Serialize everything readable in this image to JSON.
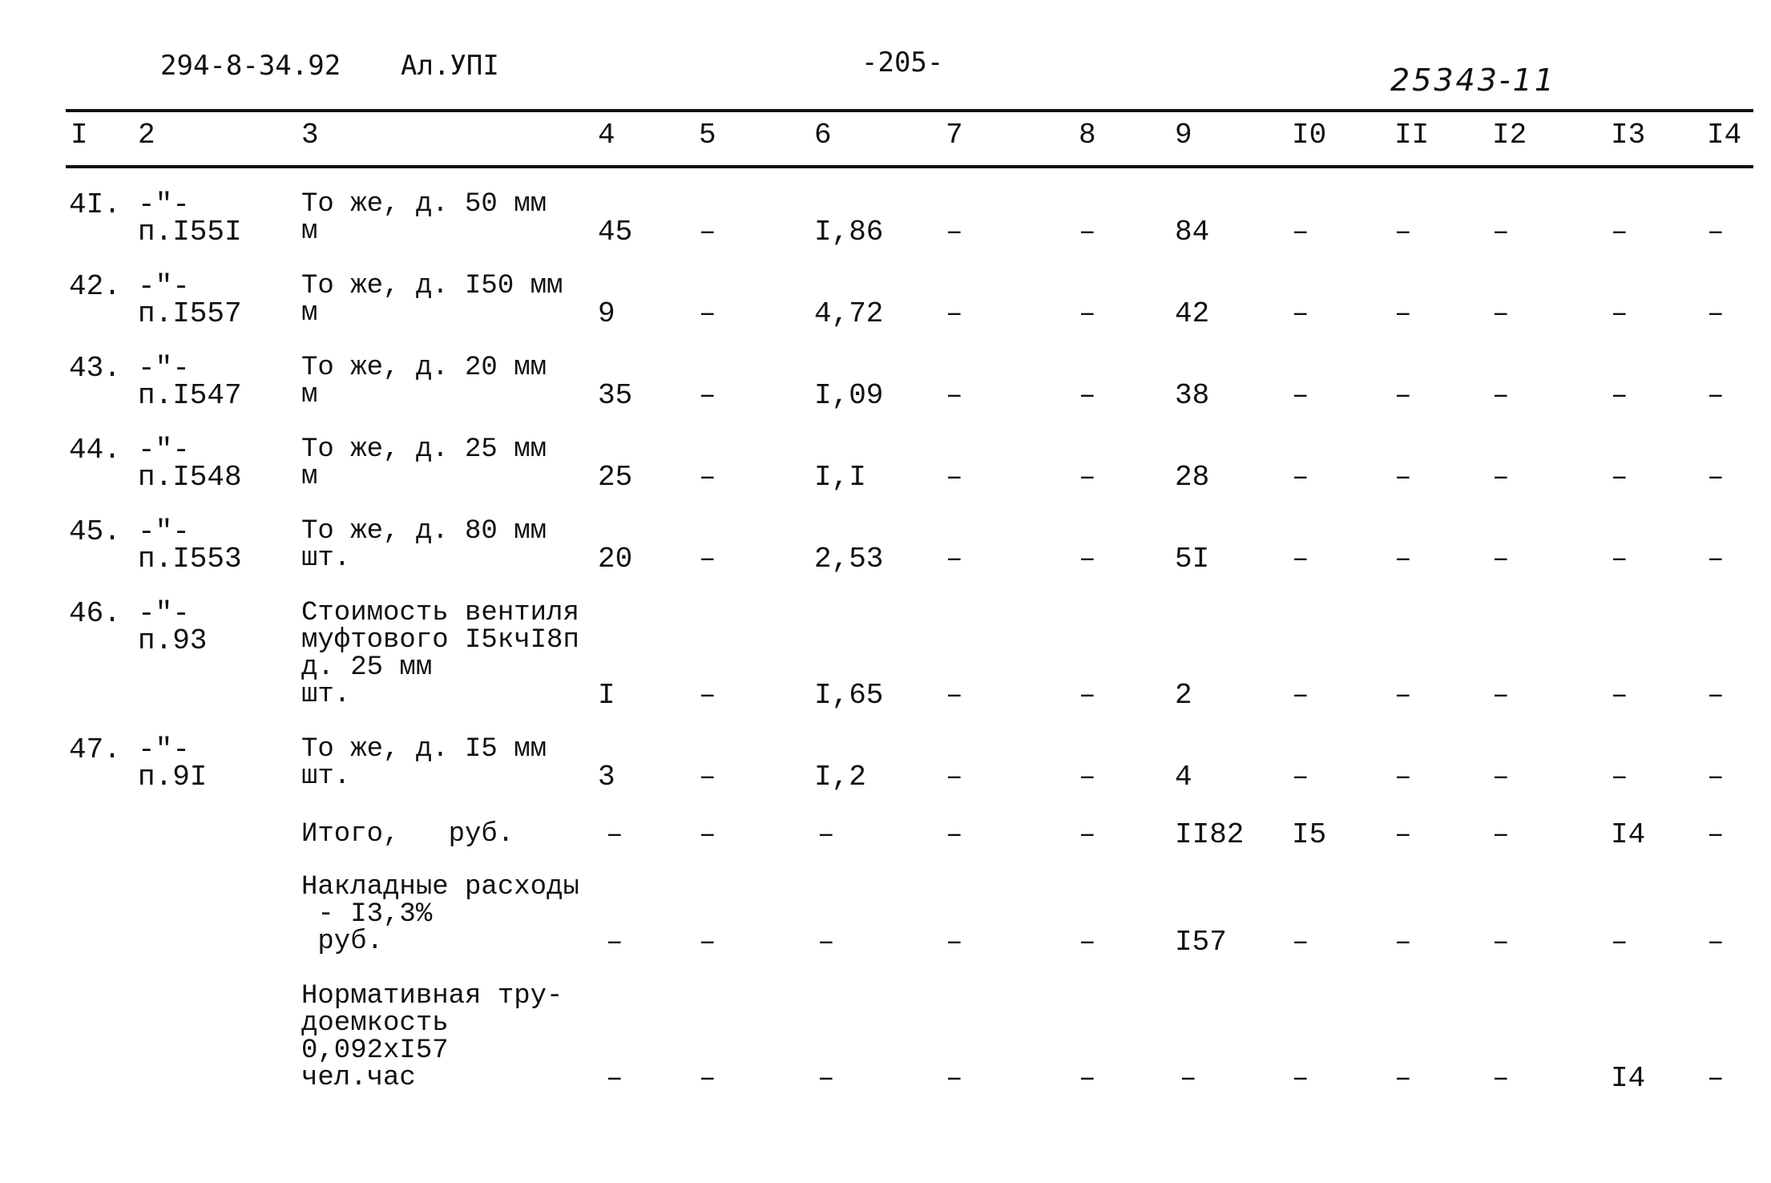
{
  "header": {
    "doc_code": "294-8-34.92",
    "album": "Ал.УПI",
    "page_number": "-205-",
    "stamp": "25343-11"
  },
  "columns": [
    "I",
    "2",
    "3",
    "4",
    "5",
    "6",
    "7",
    "8",
    "9",
    "I0",
    "II",
    "I2",
    "I3",
    "I4"
  ],
  "rows": [
    {
      "num": "4I.",
      "ref1": "-\"-",
      "ref2": "п.I55I",
      "desc": [
        "То же, д. 50 мм",
        "м"
      ],
      "c4": "45",
      "c5": "-",
      "c6": "I,86",
      "c7": "-",
      "c8": "-",
      "c9": "84",
      "c10": "-",
      "c11": "-",
      "c12": "-",
      "c13": "-",
      "c14": "-"
    },
    {
      "num": "42.",
      "ref1": "-\"-",
      "ref2": "п.I557",
      "desc": [
        "То же, д. I50 мм",
        "м"
      ],
      "c4": "9",
      "c5": "-",
      "c6": "4,72",
      "c7": "-",
      "c8": "-",
      "c9": "42",
      "c10": "-",
      "c11": "-",
      "c12": "-",
      "c13": "-",
      "c14": "-"
    },
    {
      "num": "43.",
      "ref1": "-\"-",
      "ref2": "п.I547",
      "desc": [
        "То же, д. 20 мм",
        "м"
      ],
      "c4": "35",
      "c5": "-",
      "c6": "I,09",
      "c7": "-",
      "c8": "-",
      "c9": "38",
      "c10": "-",
      "c11": "-",
      "c12": "-",
      "c13": "-",
      "c14": "-"
    },
    {
      "num": "44.",
      "ref1": "-\"-",
      "ref2": "п.I548",
      "desc": [
        "То же, д. 25 мм",
        "м"
      ],
      "c4": "25",
      "c5": "-",
      "c6": "I,I",
      "c7": "-",
      "c8": "-",
      "c9": "28",
      "c10": "-",
      "c11": "-",
      "c12": "-",
      "c13": "-",
      "c14": "-"
    },
    {
      "num": "45.",
      "ref1": "-\"-",
      "ref2": "п.I553",
      "desc": [
        "То же, д. 80 мм",
        "шт."
      ],
      "c4": "20",
      "c5": "-",
      "c6": "2,53",
      "c7": "-",
      "c8": "-",
      "c9": "5I",
      "c10": "-",
      "c11": "-",
      "c12": "-",
      "c13": "-",
      "c14": "-"
    },
    {
      "num": "46.",
      "ref1": "-\"-",
      "ref2": "п.93",
      "desc": [
        "Стоимость вентиля",
        "муфтового I5кчI8п",
        "д. 25 мм",
        "шт."
      ],
      "c4": "I",
      "c5": "-",
      "c6": "I,65",
      "c7": "-",
      "c8": "-",
      "c9": "2",
      "c10": "-",
      "c11": "-",
      "c12": "-",
      "c13": "-",
      "c14": "-"
    },
    {
      "num": "47.",
      "ref1": "-\"-",
      "ref2": "п.9I",
      "desc": [
        "То же, д. I5 мм",
        "шт."
      ],
      "c4": "3",
      "c5": "-",
      "c6": "I,2",
      "c7": "-",
      "c8": "-",
      "c9": "4",
      "c10": "-",
      "c11": "-",
      "c12": "-",
      "c13": "-",
      "c14": "-"
    }
  ],
  "summary": [
    {
      "desc": [
        "Итого,   руб."
      ],
      "c4": "-",
      "c5": "-",
      "c6": "-",
      "c7": "-",
      "c8": "-",
      "c9": "II82",
      "c10": "I5",
      "c11": "-",
      "c12": "-",
      "c13": "I4",
      "c14": "-"
    },
    {
      "desc": [
        "Накладные расходы",
        " - I3,3%",
        " руб."
      ],
      "c4": "-",
      "c5": "-",
      "c6": "-",
      "c7": "-",
      "c8": "-",
      "c9": "I57",
      "c10": "-",
      "c11": "-",
      "c12": "-",
      "c13": "-",
      "c14": "-"
    },
    {
      "desc": [
        "Нормативная тру-",
        "доемкость",
        "0,092xI57",
        "чел.час"
      ],
      "c4": "-",
      "c5": "-",
      "c6": "-",
      "c7": "-",
      "c8": "-",
      "c9": "-",
      "c10": "-",
      "c11": "-",
      "c12": "-",
      "c13": "I4",
      "c14": "-"
    }
  ]
}
